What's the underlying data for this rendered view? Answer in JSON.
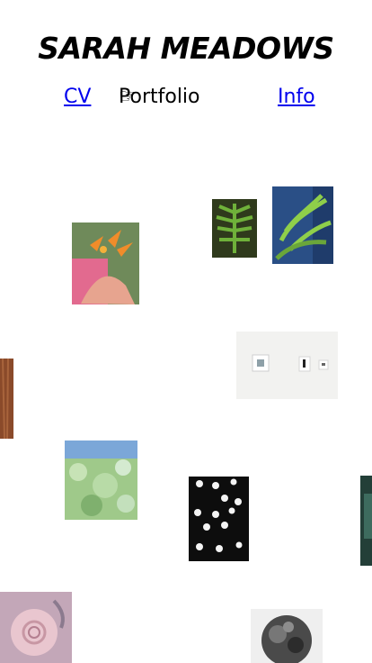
{
  "site": {
    "title": "SARAH MEADOWS"
  },
  "nav": {
    "cv_label": "CV",
    "pointer_glyph": "☞",
    "portfolio_label": "Portfolio",
    "info_label": "Info"
  },
  "colors": {
    "link": "#0000ee",
    "text": "#000000",
    "background": "#ffffff"
  }
}
